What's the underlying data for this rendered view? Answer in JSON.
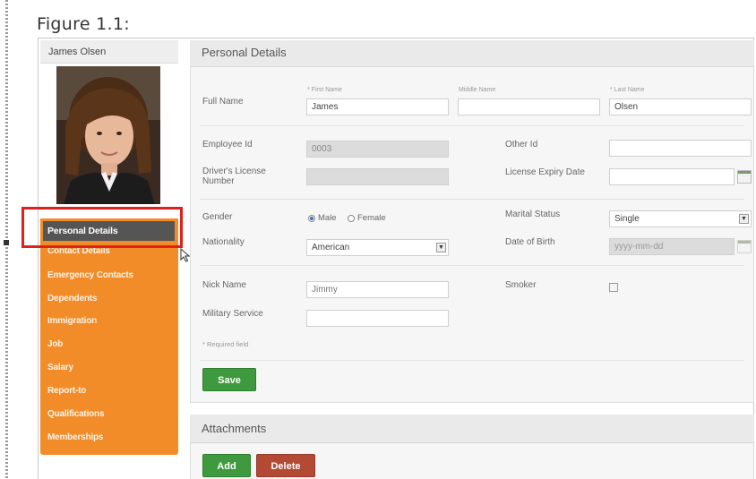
{
  "figure_title": "Figure 1.1:",
  "profile": {
    "name": "James Olsen"
  },
  "sidebar": {
    "items": [
      {
        "label": "Personal Details",
        "active": true
      },
      {
        "label": "Contact Details"
      },
      {
        "label": "Emergency Contacts"
      },
      {
        "label": "Dependents"
      },
      {
        "label": "Immigration"
      },
      {
        "label": "Job"
      },
      {
        "label": "Salary"
      },
      {
        "label": "Report-to"
      },
      {
        "label": "Qualifications"
      },
      {
        "label": "Memberships"
      }
    ]
  },
  "personal_details": {
    "header": "Personal Details",
    "full_name": {
      "label": "Full Name",
      "first_hint": "* First Name",
      "middle_hint": "Middle Name",
      "last_hint": "* Last Name",
      "first": "James",
      "middle": "",
      "last": "Olsen"
    },
    "employee_id": {
      "label": "Employee Id",
      "value": "0003"
    },
    "other_id": {
      "label": "Other Id",
      "value": ""
    },
    "drivers_license": {
      "label": "Driver's License Number",
      "value": ""
    },
    "license_expiry": {
      "label": "License Expiry Date",
      "value": ""
    },
    "gender": {
      "label": "Gender",
      "options": [
        "Male",
        "Female"
      ],
      "selected": "Male"
    },
    "marital_status": {
      "label": "Marital Status",
      "value": "Single"
    },
    "nationality": {
      "label": "Nationality",
      "value": "American"
    },
    "dob": {
      "label": "Date of Birth",
      "placeholder": "yyyy-mm-dd"
    },
    "nick_name": {
      "label": "Nick Name",
      "value": "Jimmy"
    },
    "smoker": {
      "label": "Smoker",
      "checked": false
    },
    "military_service": {
      "label": "Military Service",
      "value": ""
    },
    "required_note": "* Required field",
    "save_label": "Save"
  },
  "attachments": {
    "header": "Attachments",
    "add_label": "Add",
    "delete_label": "Delete"
  },
  "colors": {
    "sidebar_orange": "#f28c28",
    "active_item": "#555555",
    "highlight_red": "#e0211b",
    "save_green": "#3f9a3f",
    "delete_red": "#b34a34"
  }
}
